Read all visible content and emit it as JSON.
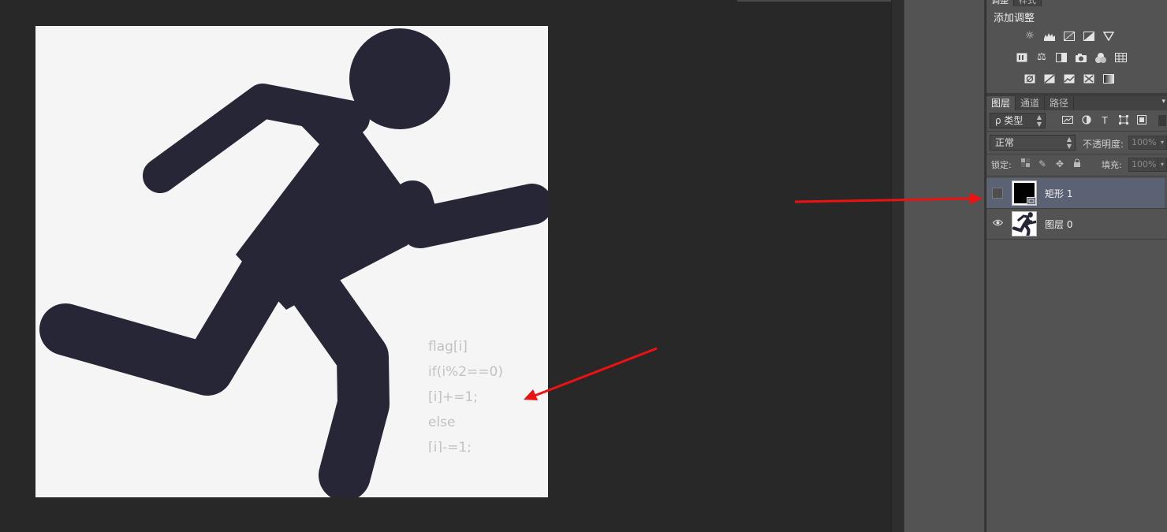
{
  "canvas": {
    "code_lines": [
      "flag[i]",
      "if(i%2==0)",
      "[i]+=1;",
      "else",
      "[i]-=1;"
    ],
    "colors": {
      "figure": "#272637",
      "background": "#f5f5f5",
      "code_text": "#c2c2c2",
      "arrow": "#ee1111"
    }
  },
  "adjustments_panel": {
    "tabs": [
      "调整",
      "样式"
    ],
    "title": "添加调整",
    "row1_icons": [
      "brightness-icon",
      "levels-icon",
      "curves-icon",
      "exposure-icon",
      "vibrance-icon"
    ],
    "row2_icons": [
      "hue-saturation-icon",
      "color-balance-icon",
      "black-white-icon",
      "photo-filter-icon",
      "channel-mixer-icon",
      "color-lookup-icon"
    ],
    "row3_icons": [
      "invert-icon",
      "posterize-icon",
      "threshold-icon",
      "selective-color-icon",
      "gradient-map-icon"
    ]
  },
  "layers_panel": {
    "tabs": [
      "图层",
      "通道",
      "路径"
    ],
    "filter_label": "ρ 类型",
    "blend_mode": "正常",
    "opacity_label": "不透明度:",
    "opacity_value": "100%",
    "lock_label": "锁定:",
    "fill_label": "填充:",
    "fill_value": "100%",
    "layers": [
      {
        "name": "矩形 1",
        "visible": false,
        "selected": true
      },
      {
        "name": "图层 0",
        "visible": true,
        "selected": false
      }
    ]
  }
}
